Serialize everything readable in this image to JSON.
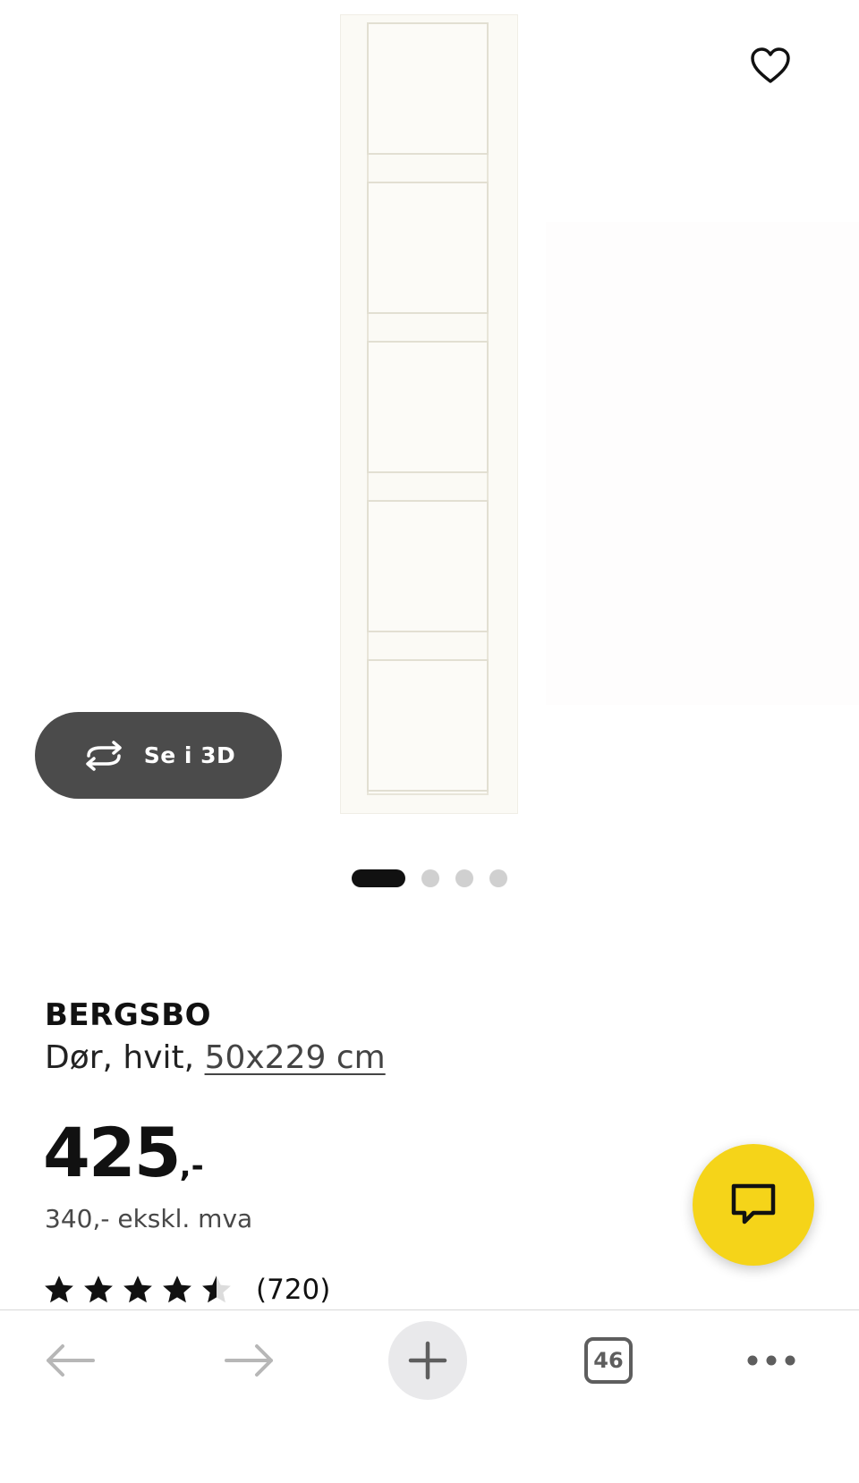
{
  "gallery": {
    "view_3d_label": "Se i 3D",
    "active_slide": 1,
    "slide_count": 4
  },
  "product": {
    "name": "BERGSBO",
    "description_prefix": "Dør, hvit, ",
    "size": "50x229 cm",
    "price_amount": "425",
    "price_suffix": ",-",
    "price_ex_vat": "340,- ekskl. mva",
    "rating_stars": 4.5,
    "rating_max": 5,
    "review_count": "(720)"
  },
  "toolbar": {
    "tab_count": "46"
  },
  "colors": {
    "accent_yellow": "#f5d419",
    "dark_button": "#4b4b4b",
    "text": "#111111"
  },
  "icons": [
    "heart-icon",
    "rotate-3d-icon",
    "chat-icon",
    "star-icon",
    "back-arrow-icon",
    "forward-arrow-icon",
    "plus-icon",
    "more-icon"
  ]
}
